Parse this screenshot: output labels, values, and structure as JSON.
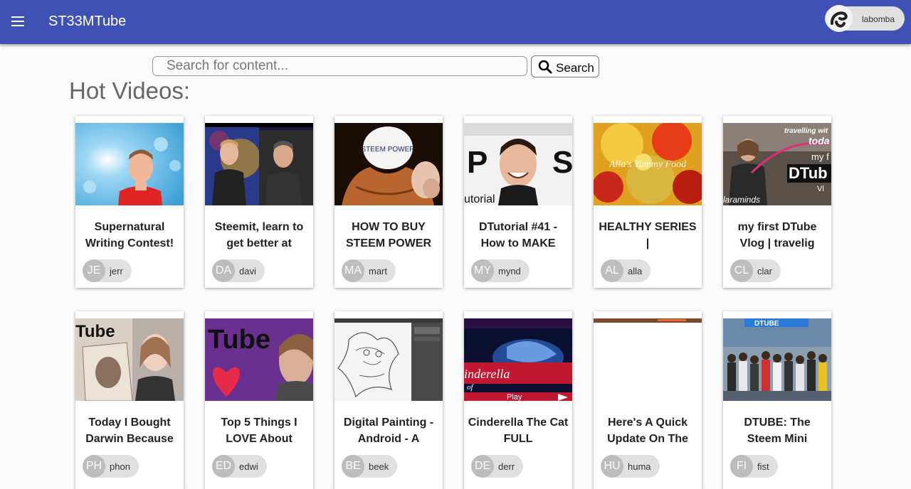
{
  "app": {
    "title": "ST33MTube"
  },
  "user": {
    "name": "labomba"
  },
  "search": {
    "placeholder": "Search for content...",
    "button_label": "Search"
  },
  "section_title": "Hot Videos:",
  "videos": [
    {
      "title": "Supernatural Writing Contest!",
      "author_initials": "JE",
      "author": "jerr"
    },
    {
      "title": "Steemit, learn to get better at",
      "author_initials": "DA",
      "author": "davi"
    },
    {
      "title": "HOW TO BUY STEEM POWER",
      "author_initials": "MA",
      "author": "mart"
    },
    {
      "title": "DTutorial #41 - How to MAKE",
      "author_initials": "MY",
      "author": "mynd"
    },
    {
      "title": "HEALTHY SERIES |",
      "author_initials": "AL",
      "author": "alla"
    },
    {
      "title": "my first DTube Vlog | travelig",
      "author_initials": "CL",
      "author": "clar"
    },
    {
      "title": "Today I Bought Darwin Because",
      "author_initials": "PH",
      "author": "phon"
    },
    {
      "title": "Top 5 Things I LOVE About",
      "author_initials": "ED",
      "author": "edwi"
    },
    {
      "title": "Digital Painting - Android - A",
      "author_initials": "BE",
      "author": "beek"
    },
    {
      "title": "Cinderella The Cat FULL",
      "author_initials": "DE",
      "author": "derr"
    },
    {
      "title": "Here's A Quick Update On The",
      "author_initials": "HU",
      "author": "huma"
    },
    {
      "title": "DTUBE: The Steem Mini",
      "author_initials": "FI",
      "author": "fist"
    }
  ],
  "thumb_text": {
    "steem_power": "STEEM POWER",
    "tutorial": "utorial",
    "food": "Alla's Yummy Food",
    "travel_1": "travelling wit",
    "travel_2": "toda",
    "travel_3": "my f",
    "travel_4": "DTub",
    "travel_5": "Vl",
    "travel_6": "laraminds",
    "tube_a": "Tube",
    "tube_b": "Tube",
    "cinderella": "inderella",
    "cinderella_2": "of",
    "play": "Play",
    "dtube_sign": "DTUBE"
  },
  "colors": {
    "appbar": "#3f51b5",
    "chip": "#e0e0e0",
    "avatar": "#bdbdbd"
  }
}
